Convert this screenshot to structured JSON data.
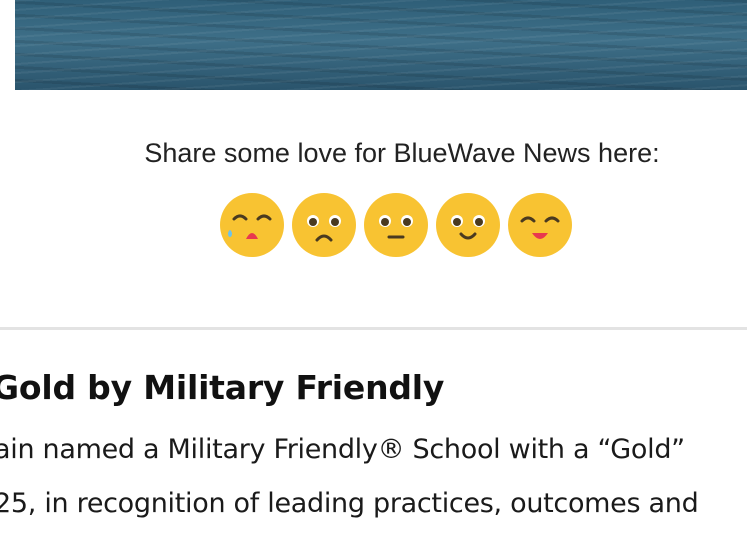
{
  "hero": {
    "alt": "ocean water"
  },
  "share": {
    "label": "Share some love for BlueWave News here:"
  },
  "reactions": [
    {
      "name": "crying"
    },
    {
      "name": "sad"
    },
    {
      "name": "neutral"
    },
    {
      "name": "smile"
    },
    {
      "name": "happy"
    }
  ],
  "article": {
    "headline": "Gold by Military Friendly",
    "body_lines": [
      "ain named a Military Friendly® School with a “Gold”",
      "25, in recognition of leading practices, outcomes and"
    ]
  },
  "colors": {
    "emoji_face": "#f8c332",
    "emoji_feature": "#4a3a20",
    "tongue": "#e8384f",
    "tear": "#6ec3ea",
    "divider": "#e3e3e3"
  }
}
